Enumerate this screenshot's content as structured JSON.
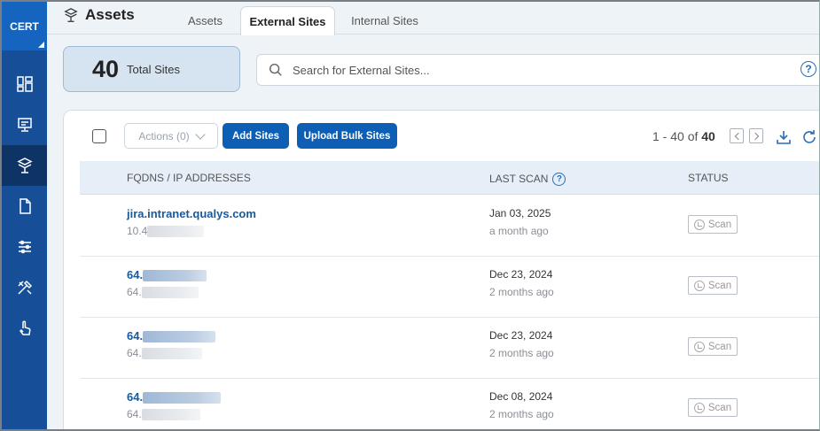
{
  "sidebar": {
    "brand": "CERT",
    "items": [
      {
        "icon": "dashboard-icon"
      },
      {
        "icon": "monitor-icon"
      },
      {
        "icon": "assets-icon",
        "active": true
      },
      {
        "icon": "document-icon"
      },
      {
        "icon": "sliders-icon"
      },
      {
        "icon": "tools-icon"
      },
      {
        "icon": "hand-pointer-icon"
      }
    ]
  },
  "header": {
    "title": "Assets",
    "tabs": [
      "Assets",
      "External Sites",
      "Internal Sites"
    ],
    "active_tab": "External Sites"
  },
  "summary": {
    "total_count": "40",
    "total_label": "Total Sites"
  },
  "search": {
    "placeholder": "Search for External Sites...",
    "help": "?"
  },
  "toolbar": {
    "actions_label": "Actions (0)",
    "add_label": "Add Sites",
    "upload_label": "Upload Bulk Sites",
    "pager_range": "1 - 40 of",
    "pager_total": "40"
  },
  "table": {
    "columns": {
      "fqdn": "FQDNS / IP ADDRESSES",
      "last_scan": "LAST SCAN",
      "status": "STATUS"
    },
    "rows": [
      {
        "fqdn": "jira.intranet.qualys.com",
        "ip": "10.4",
        "date": "Jan 03, 2025",
        "ago": "a month ago",
        "status": "Scan"
      },
      {
        "fqdn": "64.",
        "ip": "64.",
        "date": "Dec 23, 2024",
        "ago": "2 months ago",
        "status": "Scan"
      },
      {
        "fqdn": "64.",
        "ip": "64.",
        "date": "Dec 23, 2024",
        "ago": "2 months ago",
        "status": "Scan"
      },
      {
        "fqdn": "64.",
        "ip": "64.",
        "date": "Dec 08, 2024",
        "ago": "2 months ago",
        "status": "Scan"
      }
    ]
  },
  "colors": {
    "sidebar": "#164e98",
    "brand": "#1565c0",
    "primary": "#0d5fb5",
    "link": "#165a9e"
  }
}
